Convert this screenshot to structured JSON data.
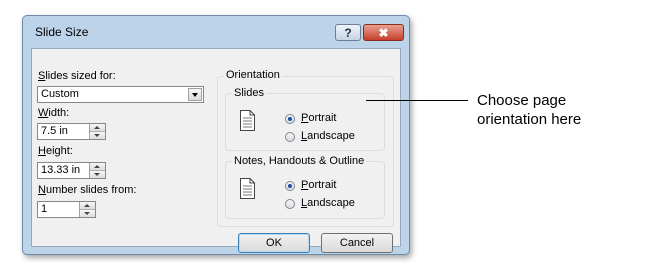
{
  "window": {
    "title": "Slide Size",
    "help_glyph": "?",
    "close_glyph": "✖"
  },
  "left": {
    "slides_sized_for": {
      "label_u": "S",
      "label_rest": "lides sized for:",
      "value": "Custom"
    },
    "width": {
      "label_u": "W",
      "label_rest": "idth:",
      "value": "7.5 in"
    },
    "height": {
      "label_u": "H",
      "label_rest": "eight:",
      "value": "13.33 in"
    },
    "number_from": {
      "label_u": "N",
      "label_rest": "umber slides from:",
      "value": "1"
    }
  },
  "orientation": {
    "title": "Orientation",
    "slides": {
      "title": "Slides",
      "portrait": {
        "label_u": "P",
        "label_rest": "ortrait",
        "checked": true
      },
      "landscape": {
        "label_u": "L",
        "label_rest": "andscape",
        "checked": false
      }
    },
    "notes": {
      "title": "Notes, Handouts & Outline",
      "portrait": {
        "label_u": "P",
        "label_rest": "ortrait",
        "checked": true
      },
      "landscape": {
        "label_u": "L",
        "label_rest": "andscape",
        "checked": false
      }
    }
  },
  "buttons": {
    "ok": "OK",
    "cancel": "Cancel"
  },
  "annotation": {
    "line1": "Choose page",
    "line2": "orientation here"
  },
  "icons": {
    "help": "help-icon",
    "close": "close-icon",
    "page": "portrait-page-icon"
  },
  "colors": {
    "frame": "#bdd3ea",
    "client": "#f0f0f0",
    "close_button": "#c4402a",
    "radio_dot": "#1e4fa6"
  }
}
